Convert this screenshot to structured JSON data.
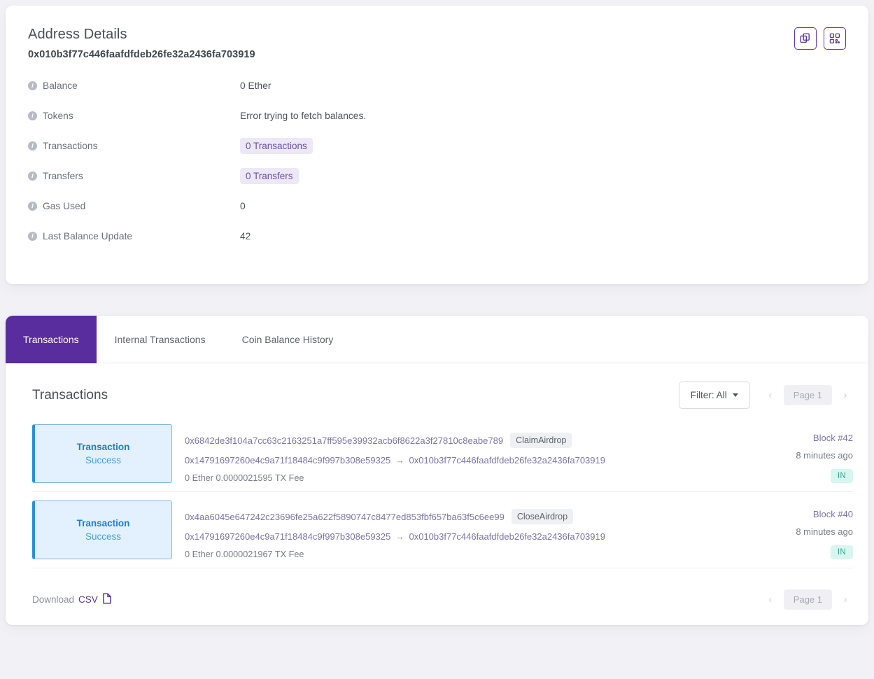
{
  "details": {
    "title": "Address Details",
    "hash": "0x010b3f77c446faafdfdeb26fe32a2436fa703919",
    "actions": [
      {
        "name": "copy-icon",
        "label": "Copy address"
      },
      {
        "name": "qr-code-icon",
        "label": "Show QR code"
      }
    ],
    "rows": [
      {
        "label": "Balance",
        "value": "0 Ether",
        "type": "text"
      },
      {
        "label": "Tokens",
        "value": "Error trying to fetch balances.",
        "type": "text"
      },
      {
        "label": "Transactions",
        "value": "0 Transactions",
        "type": "pill"
      },
      {
        "label": "Transfers",
        "value": "0 Transfers",
        "type": "pill"
      },
      {
        "label": "Gas Used",
        "value": "0",
        "type": "text"
      },
      {
        "label": "Last Balance Update",
        "value": "42",
        "type": "text"
      }
    ]
  },
  "tabs": [
    {
      "label": "Transactions",
      "active": true
    },
    {
      "label": "Internal Transactions",
      "active": false
    },
    {
      "label": "Coin Balance History",
      "active": false
    }
  ],
  "transactions_panel": {
    "title": "Transactions",
    "filter_label": "Filter: All",
    "pager": {
      "prev": "‹",
      "page_label": "Page 1",
      "next": "›"
    },
    "download": {
      "prefix": "Download",
      "suffix": "CSV",
      "icon": "document-icon"
    },
    "items": [
      {
        "kind": "Transaction",
        "status": "Success",
        "hash": "0x6842de3f104a7cc63c2163251a7ff595e39932acb6f8622a3f27810c8eabe789",
        "method": "ClaimAirdrop",
        "from": "0x14791697260e4c9a71f18484c9f997b308e59325",
        "arrow": "→",
        "to": "0x010b3f77c446faafdfdeb26fe32a2436fa703919",
        "value": "0 Ether",
        "fee": "0.0000021595 TX Fee",
        "block": "Block #42",
        "age": "8 minutes ago",
        "direction": "IN"
      },
      {
        "kind": "Transaction",
        "status": "Success",
        "hash": "0x4aa6045e647242c23696fe25a622f5890747c8477ed853fbf657ba63f5c6ee99",
        "method": "CloseAirdrop",
        "from": "0x14791697260e4c9a71f18484c9f997b308e59325",
        "arrow": "→",
        "to": "0x010b3f77c446faafdfdeb26fe32a2436fa703919",
        "value": "0 Ether",
        "fee": "0.0000021967 TX Fee",
        "block": "Block #40",
        "age": "8 minutes ago",
        "direction": "IN"
      }
    ]
  },
  "colors": {
    "brand_purple": "#5a2d9e",
    "page_bg": "#f2f2f6",
    "status_blue": "#2d8de0",
    "badge_teal": "#3aa98f"
  }
}
